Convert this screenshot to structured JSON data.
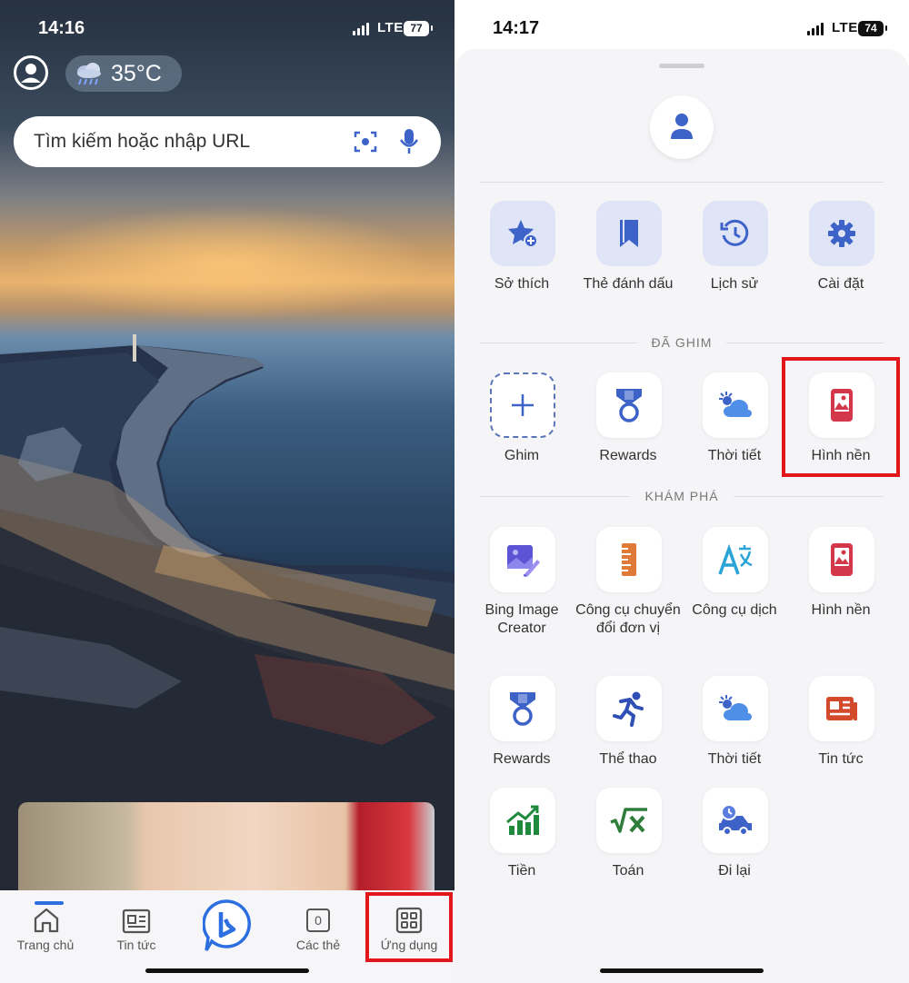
{
  "left_screen": {
    "status": {
      "time": "14:16",
      "network": "LTE",
      "battery": "77"
    },
    "weather": {
      "temperature": "35°C",
      "icon": "rain-cloud-icon"
    },
    "search": {
      "placeholder": "Tìm kiếm hoặc nhập URL"
    },
    "bottom_nav": [
      {
        "label": "Trang chủ",
        "icon": "home-icon",
        "active": true
      },
      {
        "label": "Tin tức",
        "icon": "news-icon"
      },
      {
        "label": "",
        "icon": "bing-logo-icon"
      },
      {
        "label": "Các thẻ",
        "icon": "tabs-icon",
        "count": "0"
      },
      {
        "label": "Ứng dụng",
        "icon": "apps-grid-icon",
        "highlighted": true
      }
    ]
  },
  "right_screen": {
    "status": {
      "time": "14:17",
      "network": "LTE",
      "battery": "74"
    },
    "top_items": [
      {
        "label": "Sở thích",
        "icon": "star-plus-icon"
      },
      {
        "label": "Thẻ đánh dấu",
        "icon": "bookmark-icon"
      },
      {
        "label": "Lịch sử",
        "icon": "history-icon"
      },
      {
        "label": "Cài đặt",
        "icon": "gear-icon"
      }
    ],
    "pinned": {
      "title": "ĐÃ GHIM",
      "items": [
        {
          "label": "Ghim",
          "icon": "plus-icon"
        },
        {
          "label": "Rewards",
          "icon": "medal-icon"
        },
        {
          "label": "Thời tiết",
          "icon": "weather-icon"
        },
        {
          "label": "Hình nền",
          "icon": "wallpaper-icon",
          "highlighted": true
        }
      ]
    },
    "explore": {
      "title": "KHÁM PHÁ",
      "items": [
        {
          "label": "Bing Image Creator",
          "icon": "image-creator-icon"
        },
        {
          "label": "Công cụ chuyển đổi đơn vị",
          "icon": "ruler-icon"
        },
        {
          "label": "Công cụ dịch",
          "icon": "translate-icon"
        },
        {
          "label": "Hình nền",
          "icon": "wallpaper-icon"
        },
        {
          "label": "Rewards",
          "icon": "medal-icon"
        },
        {
          "label": "Thể thao",
          "icon": "runner-icon"
        },
        {
          "label": "Thời tiết",
          "icon": "weather-icon"
        },
        {
          "label": "Tin tức",
          "icon": "news-icon"
        },
        {
          "label": "Tiền",
          "icon": "money-chart-icon"
        },
        {
          "label": "Toán",
          "icon": "math-icon"
        },
        {
          "label": "Đi lại",
          "icon": "travel-car-icon"
        }
      ]
    }
  },
  "colors": {
    "accent": "#2d6fe0",
    "highlight": "#e3161c",
    "icon_blue": "#3d63c9",
    "wallpaper_red": "#d3374a",
    "ruler_orange": "#e07a38",
    "sports_blue": "#2f4fb6",
    "news_red": "#d24a2a",
    "money_green": "#1f8a3c",
    "math_green": "#2f7d3a"
  }
}
